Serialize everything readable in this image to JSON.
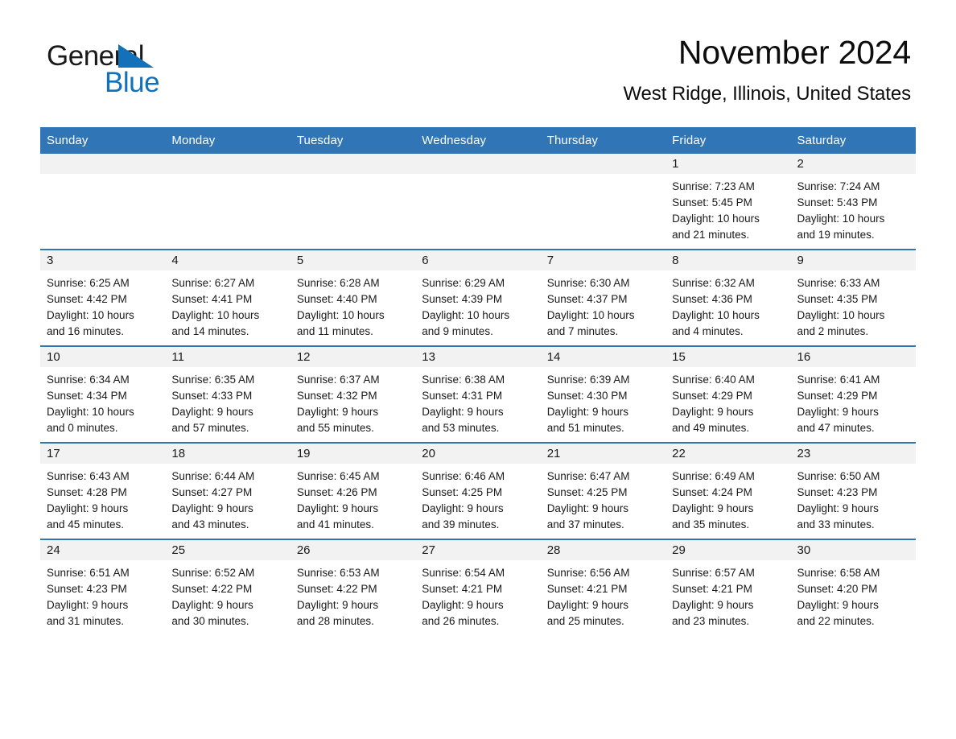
{
  "brand": {
    "word1": "General",
    "word2": "Blue",
    "triangle_color": "#1271b8"
  },
  "header": {
    "month_title": "November 2024",
    "location": "West Ridge, Illinois, United States"
  },
  "theme": {
    "header_blue": "#3075b5",
    "daynum_band": "#f2f2f2",
    "text": "#1a1a1a"
  },
  "calendar": {
    "weekday_headers": [
      "Sunday",
      "Monday",
      "Tuesday",
      "Wednesday",
      "Thursday",
      "Friday",
      "Saturday"
    ],
    "weeks": [
      [
        {
          "day": "",
          "empty": true,
          "sunrise": "",
          "sunset": "",
          "daylight_line1": "",
          "daylight_line2": ""
        },
        {
          "day": "",
          "empty": true,
          "sunrise": "",
          "sunset": "",
          "daylight_line1": "",
          "daylight_line2": ""
        },
        {
          "day": "",
          "empty": true,
          "sunrise": "",
          "sunset": "",
          "daylight_line1": "",
          "daylight_line2": ""
        },
        {
          "day": "",
          "empty": true,
          "sunrise": "",
          "sunset": "",
          "daylight_line1": "",
          "daylight_line2": ""
        },
        {
          "day": "",
          "empty": true,
          "sunrise": "",
          "sunset": "",
          "daylight_line1": "",
          "daylight_line2": ""
        },
        {
          "day": "1",
          "empty": false,
          "sunrise": "Sunrise: 7:23 AM",
          "sunset": "Sunset: 5:45 PM",
          "daylight_line1": "Daylight: 10 hours",
          "daylight_line2": "and 21 minutes."
        },
        {
          "day": "2",
          "empty": false,
          "sunrise": "Sunrise: 7:24 AM",
          "sunset": "Sunset: 5:43 PM",
          "daylight_line1": "Daylight: 10 hours",
          "daylight_line2": "and 19 minutes."
        }
      ],
      [
        {
          "day": "3",
          "empty": false,
          "sunrise": "Sunrise: 6:25 AM",
          "sunset": "Sunset: 4:42 PM",
          "daylight_line1": "Daylight: 10 hours",
          "daylight_line2": "and 16 minutes."
        },
        {
          "day": "4",
          "empty": false,
          "sunrise": "Sunrise: 6:27 AM",
          "sunset": "Sunset: 4:41 PM",
          "daylight_line1": "Daylight: 10 hours",
          "daylight_line2": "and 14 minutes."
        },
        {
          "day": "5",
          "empty": false,
          "sunrise": "Sunrise: 6:28 AM",
          "sunset": "Sunset: 4:40 PM",
          "daylight_line1": "Daylight: 10 hours",
          "daylight_line2": "and 11 minutes."
        },
        {
          "day": "6",
          "empty": false,
          "sunrise": "Sunrise: 6:29 AM",
          "sunset": "Sunset: 4:39 PM",
          "daylight_line1": "Daylight: 10 hours",
          "daylight_line2": "and 9 minutes."
        },
        {
          "day": "7",
          "empty": false,
          "sunrise": "Sunrise: 6:30 AM",
          "sunset": "Sunset: 4:37 PM",
          "daylight_line1": "Daylight: 10 hours",
          "daylight_line2": "and 7 minutes."
        },
        {
          "day": "8",
          "empty": false,
          "sunrise": "Sunrise: 6:32 AM",
          "sunset": "Sunset: 4:36 PM",
          "daylight_line1": "Daylight: 10 hours",
          "daylight_line2": "and 4 minutes."
        },
        {
          "day": "9",
          "empty": false,
          "sunrise": "Sunrise: 6:33 AM",
          "sunset": "Sunset: 4:35 PM",
          "daylight_line1": "Daylight: 10 hours",
          "daylight_line2": "and 2 minutes."
        }
      ],
      [
        {
          "day": "10",
          "empty": false,
          "sunrise": "Sunrise: 6:34 AM",
          "sunset": "Sunset: 4:34 PM",
          "daylight_line1": "Daylight: 10 hours",
          "daylight_line2": "and 0 minutes."
        },
        {
          "day": "11",
          "empty": false,
          "sunrise": "Sunrise: 6:35 AM",
          "sunset": "Sunset: 4:33 PM",
          "daylight_line1": "Daylight: 9 hours",
          "daylight_line2": "and 57 minutes."
        },
        {
          "day": "12",
          "empty": false,
          "sunrise": "Sunrise: 6:37 AM",
          "sunset": "Sunset: 4:32 PM",
          "daylight_line1": "Daylight: 9 hours",
          "daylight_line2": "and 55 minutes."
        },
        {
          "day": "13",
          "empty": false,
          "sunrise": "Sunrise: 6:38 AM",
          "sunset": "Sunset: 4:31 PM",
          "daylight_line1": "Daylight: 9 hours",
          "daylight_line2": "and 53 minutes."
        },
        {
          "day": "14",
          "empty": false,
          "sunrise": "Sunrise: 6:39 AM",
          "sunset": "Sunset: 4:30 PM",
          "daylight_line1": "Daylight: 9 hours",
          "daylight_line2": "and 51 minutes."
        },
        {
          "day": "15",
          "empty": false,
          "sunrise": "Sunrise: 6:40 AM",
          "sunset": "Sunset: 4:29 PM",
          "daylight_line1": "Daylight: 9 hours",
          "daylight_line2": "and 49 minutes."
        },
        {
          "day": "16",
          "empty": false,
          "sunrise": "Sunrise: 6:41 AM",
          "sunset": "Sunset: 4:29 PM",
          "daylight_line1": "Daylight: 9 hours",
          "daylight_line2": "and 47 minutes."
        }
      ],
      [
        {
          "day": "17",
          "empty": false,
          "sunrise": "Sunrise: 6:43 AM",
          "sunset": "Sunset: 4:28 PM",
          "daylight_line1": "Daylight: 9 hours",
          "daylight_line2": "and 45 minutes."
        },
        {
          "day": "18",
          "empty": false,
          "sunrise": "Sunrise: 6:44 AM",
          "sunset": "Sunset: 4:27 PM",
          "daylight_line1": "Daylight: 9 hours",
          "daylight_line2": "and 43 minutes."
        },
        {
          "day": "19",
          "empty": false,
          "sunrise": "Sunrise: 6:45 AM",
          "sunset": "Sunset: 4:26 PM",
          "daylight_line1": "Daylight: 9 hours",
          "daylight_line2": "and 41 minutes."
        },
        {
          "day": "20",
          "empty": false,
          "sunrise": "Sunrise: 6:46 AM",
          "sunset": "Sunset: 4:25 PM",
          "daylight_line1": "Daylight: 9 hours",
          "daylight_line2": "and 39 minutes."
        },
        {
          "day": "21",
          "empty": false,
          "sunrise": "Sunrise: 6:47 AM",
          "sunset": "Sunset: 4:25 PM",
          "daylight_line1": "Daylight: 9 hours",
          "daylight_line2": "and 37 minutes."
        },
        {
          "day": "22",
          "empty": false,
          "sunrise": "Sunrise: 6:49 AM",
          "sunset": "Sunset: 4:24 PM",
          "daylight_line1": "Daylight: 9 hours",
          "daylight_line2": "and 35 minutes."
        },
        {
          "day": "23",
          "empty": false,
          "sunrise": "Sunrise: 6:50 AM",
          "sunset": "Sunset: 4:23 PM",
          "daylight_line1": "Daylight: 9 hours",
          "daylight_line2": "and 33 minutes."
        }
      ],
      [
        {
          "day": "24",
          "empty": false,
          "sunrise": "Sunrise: 6:51 AM",
          "sunset": "Sunset: 4:23 PM",
          "daylight_line1": "Daylight: 9 hours",
          "daylight_line2": "and 31 minutes."
        },
        {
          "day": "25",
          "empty": false,
          "sunrise": "Sunrise: 6:52 AM",
          "sunset": "Sunset: 4:22 PM",
          "daylight_line1": "Daylight: 9 hours",
          "daylight_line2": "and 30 minutes."
        },
        {
          "day": "26",
          "empty": false,
          "sunrise": "Sunrise: 6:53 AM",
          "sunset": "Sunset: 4:22 PM",
          "daylight_line1": "Daylight: 9 hours",
          "daylight_line2": "and 28 minutes."
        },
        {
          "day": "27",
          "empty": false,
          "sunrise": "Sunrise: 6:54 AM",
          "sunset": "Sunset: 4:21 PM",
          "daylight_line1": "Daylight: 9 hours",
          "daylight_line2": "and 26 minutes."
        },
        {
          "day": "28",
          "empty": false,
          "sunrise": "Sunrise: 6:56 AM",
          "sunset": "Sunset: 4:21 PM",
          "daylight_line1": "Daylight: 9 hours",
          "daylight_line2": "and 25 minutes."
        },
        {
          "day": "29",
          "empty": false,
          "sunrise": "Sunrise: 6:57 AM",
          "sunset": "Sunset: 4:21 PM",
          "daylight_line1": "Daylight: 9 hours",
          "daylight_line2": "and 23 minutes."
        },
        {
          "day": "30",
          "empty": false,
          "sunrise": "Sunrise: 6:58 AM",
          "sunset": "Sunset: 4:20 PM",
          "daylight_line1": "Daylight: 9 hours",
          "daylight_line2": "and 22 minutes."
        }
      ]
    ]
  }
}
